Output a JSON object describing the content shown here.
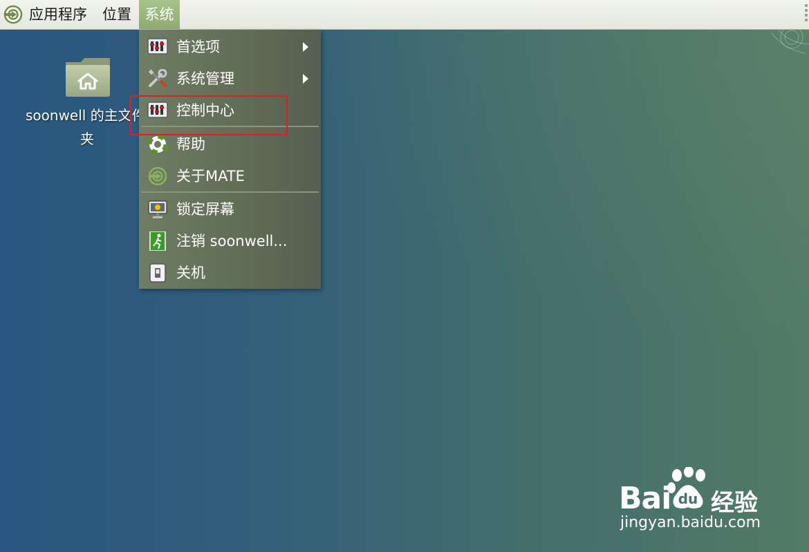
{
  "panel": {
    "menus": [
      {
        "label": "应用程序",
        "icon": "mate-logo-icon"
      },
      {
        "label": "位置"
      },
      {
        "label": "系统",
        "active": true
      }
    ]
  },
  "system_menu": {
    "items": [
      {
        "label": "首选项",
        "icon": "preferences-icon",
        "submenu": true
      },
      {
        "label": "系统管理",
        "icon": "administration-tools-icon",
        "submenu": true
      },
      {
        "label": "控制中心",
        "icon": "control-center-icon",
        "highlighted": true
      },
      {
        "label": "帮助",
        "icon": "help-lifebuoy-icon"
      },
      {
        "label": "关于MATE",
        "icon": "mate-logo-icon"
      },
      {
        "label": "锁定屏幕",
        "icon": "lock-screen-icon"
      },
      {
        "label": "注销 soonwell...",
        "icon": "logout-exit-icon"
      },
      {
        "label": "关机",
        "icon": "shutdown-icon"
      }
    ]
  },
  "desktop": {
    "home_folder": {
      "label_line1": "soonwell 的主文件",
      "label_line2": "夹",
      "icon": "home-folder-icon"
    }
  },
  "watermark": {
    "brand_text": "Bai",
    "brand_suffix": "经验",
    "url": "jingyan.baidu.com",
    "icon": "baidu-paw-icon"
  },
  "colors": {
    "highlight_box": "#e21c24",
    "active_menu": "#9ab77e",
    "menu_background": "#626e59"
  }
}
